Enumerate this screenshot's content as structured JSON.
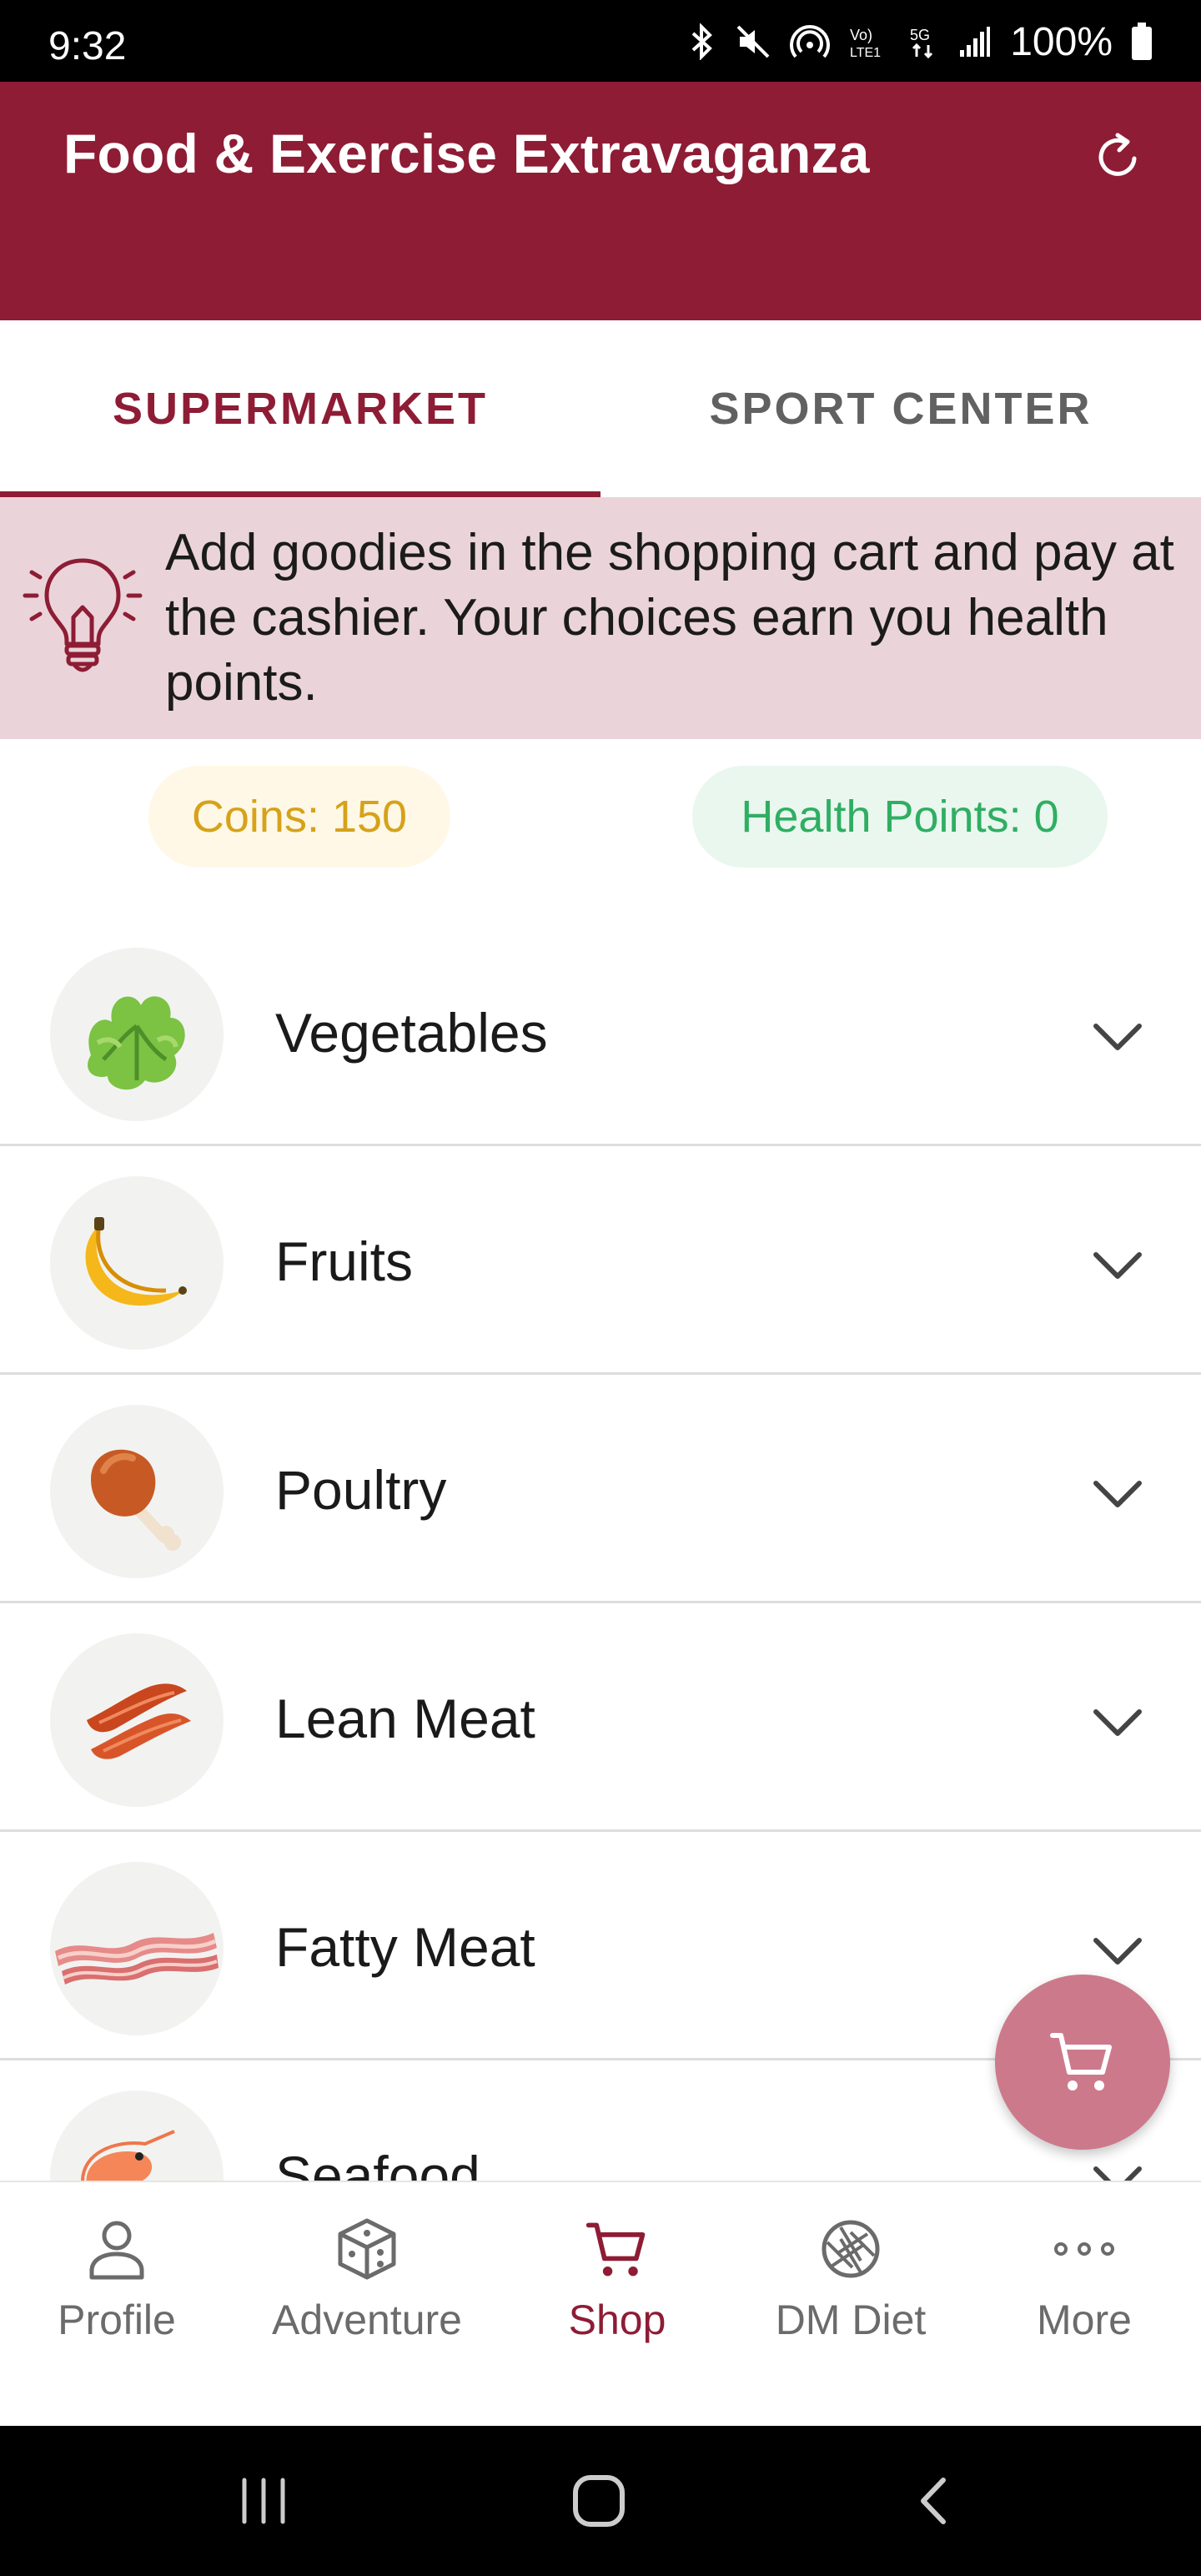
{
  "status_bar": {
    "time": "9:32",
    "battery": "100%"
  },
  "app": {
    "title": "Food & Exercise Extravaganza"
  },
  "tabs": [
    {
      "label": "SUPERMARKET",
      "active": true
    },
    {
      "label": "SPORT CENTER",
      "active": false
    }
  ],
  "hint": {
    "text": "Add goodies in the shopping cart and pay at the cashier. Your choices earn you health points."
  },
  "stats": {
    "coins": "Coins: 150",
    "health": "Health Points: 0"
  },
  "categories": [
    {
      "label": "Vegetables",
      "icon": "lettuce-icon"
    },
    {
      "label": "Fruits",
      "icon": "banana-icon"
    },
    {
      "label": "Poultry",
      "icon": "chicken-leg-icon"
    },
    {
      "label": "Lean Meat",
      "icon": "lean-meat-icon"
    },
    {
      "label": "Fatty Meat",
      "icon": "bacon-icon"
    },
    {
      "label": "Seafood",
      "icon": "shrimp-icon"
    }
  ],
  "bottom_nav": [
    {
      "label": "Profile",
      "icon": "person-icon"
    },
    {
      "label": "Adventure",
      "icon": "dice-icon"
    },
    {
      "label": "Shop",
      "icon": "cart-icon",
      "active": true
    },
    {
      "label": "DM Diet",
      "icon": "aperture-icon"
    },
    {
      "label": "More",
      "icon": "more-dots-icon"
    }
  ],
  "colors": {
    "primary": "#8e1c35",
    "banner": "#ead4d9",
    "coins_text": "#d6a21a",
    "health_text": "#2fae62",
    "fab": "#cc7a8b"
  }
}
